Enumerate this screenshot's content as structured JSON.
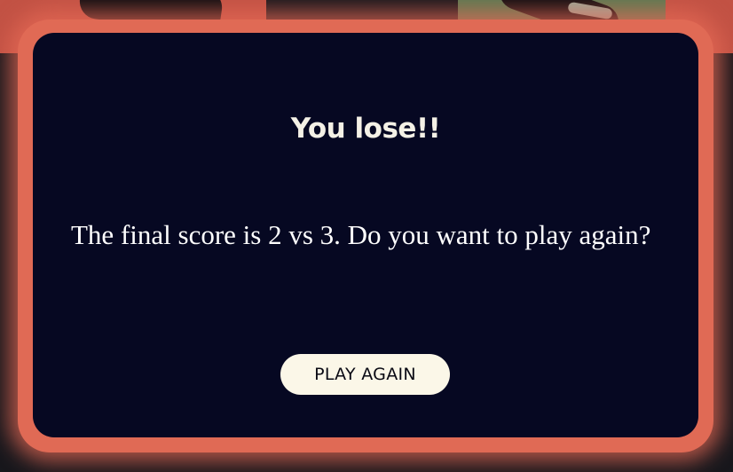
{
  "modal": {
    "title": "You lose!!",
    "message": "The final score is 2 vs 3. Do you want to play again?",
    "button_label": "PLAY AGAIN"
  },
  "score": {
    "player": 2,
    "opponent": 3
  },
  "colors": {
    "modal_background": "#060822",
    "modal_border_glow": "#e06a55",
    "button_background": "#fbf7e8",
    "text": "#ffffff"
  }
}
